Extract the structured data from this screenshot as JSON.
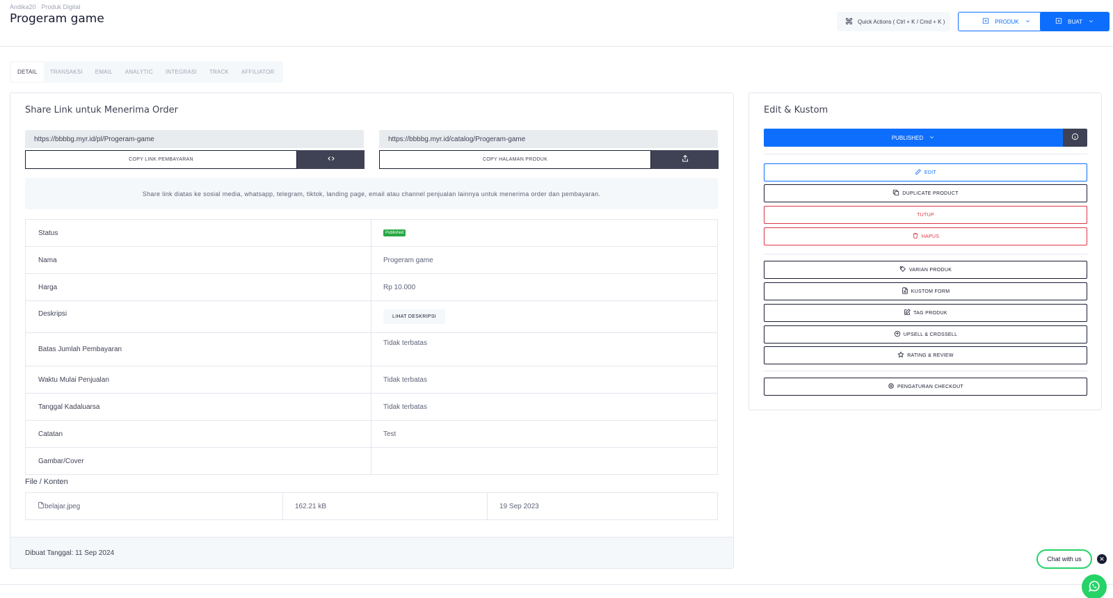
{
  "header": {
    "breadcrumb": [
      "Andika20",
      "Produk Digital"
    ],
    "title": "Progeram game",
    "quick_actions_label": "Quick Actions ( Ctrl + K / Cmd + K )",
    "produk_label": "PRODUK",
    "buat_label": "BUAT"
  },
  "tabs": [
    {
      "label": "DETAIL",
      "active": true
    },
    {
      "label": "TRANSAKSI"
    },
    {
      "label": "EMAIL"
    },
    {
      "label": "ANALYTIC"
    },
    {
      "label": "INTEGRASI"
    },
    {
      "label": "TRACK"
    },
    {
      "label": "AFFILIATOR"
    }
  ],
  "share": {
    "title": "Share Link untuk Menerima Order",
    "payment_url": "https://bbbbg.myr.id/pl/Progeram-game",
    "copy_payment_label": "COPY LINK PEMBAYARAN",
    "catalog_url": "https://bbbbg.myr.id/catalog/Progeram-game",
    "copy_catalog_label": "COPY HALAMAN PRODUK",
    "note": "Share link diatas ke sosial media, whatsapp, telegram, tiktok, landing page, email atau channel penjualan lainnya untuk menerima order dan pembayaran."
  },
  "details": {
    "status_label": "Status",
    "status_value": "Published",
    "nama_label": "Nama",
    "nama_value": "Progeram game",
    "harga_label": "Harga",
    "harga_value": "Rp 10.000",
    "deskripsi_label": "Deskripsi",
    "deskripsi_button": "LIHAT DESKRIPSI",
    "batas_label": "Batas Jumlah Pembayaran",
    "batas_value": "Tidak terbatas",
    "waktu_label": "Waktu Mulai Penjualan",
    "waktu_value": "Tidak terbatas",
    "tanggal_label": "Tanggal Kadaluarsa",
    "tanggal_value": "Tidak terbatas",
    "catatan_label": "Catatan",
    "catatan_value": "Test",
    "gambar_label": "Gambar/Cover",
    "gambar_value": ""
  },
  "files": {
    "title": "File / Konten",
    "name": "belajar.jpeg",
    "size": "162.21 kB",
    "date": "19 Sep 2023"
  },
  "footer": {
    "created": "Dibuat Tanggal: 11 Sep 2024"
  },
  "edit_panel": {
    "title": "Edit & Kustom",
    "published_label": "PUBLISHED",
    "edit_label": "EDIT",
    "duplicate_label": "DUPLICATE PRODUCT",
    "tutup_label": "TUTUP",
    "hapus_label": "HAPUS",
    "varian_label": "VARIAN PRODUK",
    "kustom_label": "KUSTOM FORM",
    "tag_label": "TAG PRODUK",
    "upsell_label": "UPSELL & CROSSELL",
    "rating_label": "RATING & REVIEW",
    "pengaturan_label": "PENGATURAN CHECKOUT"
  },
  "chat": {
    "label": "Chat with us"
  },
  "colors": {
    "primary": "#0d6efd",
    "dark": "#3f4254",
    "danger": "#dc3545",
    "success": "#28a745",
    "whatsapp": "#25d366"
  }
}
